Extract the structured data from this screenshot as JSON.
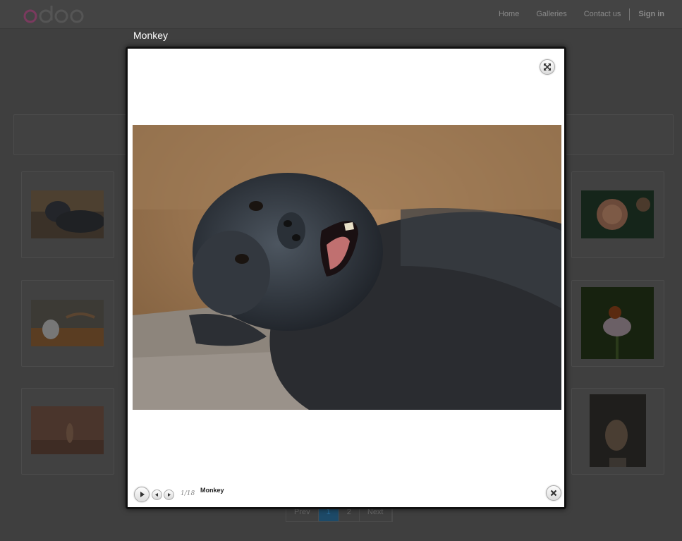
{
  "navbar": {
    "logo_text": "odoo",
    "links": [
      "Home",
      "Galleries",
      "Contact us"
    ],
    "sign_in": "Sign in"
  },
  "pager": {
    "prev": "Prev",
    "pages": [
      "1",
      "2"
    ],
    "next": "Next",
    "current": "1"
  },
  "lightbox": {
    "title": "Monkey",
    "caption": "Monkey",
    "counter": "1/18"
  },
  "thumbnails": [
    {
      "name": "gorilla"
    },
    {
      "name": "fish"
    },
    {
      "name": "dog-art"
    },
    {
      "name": "flower-ladybug"
    },
    {
      "name": "meerkat"
    },
    {
      "name": "bird"
    }
  ],
  "colors": {
    "background": "#3f3f3f",
    "active_page": "#1d4a68"
  }
}
